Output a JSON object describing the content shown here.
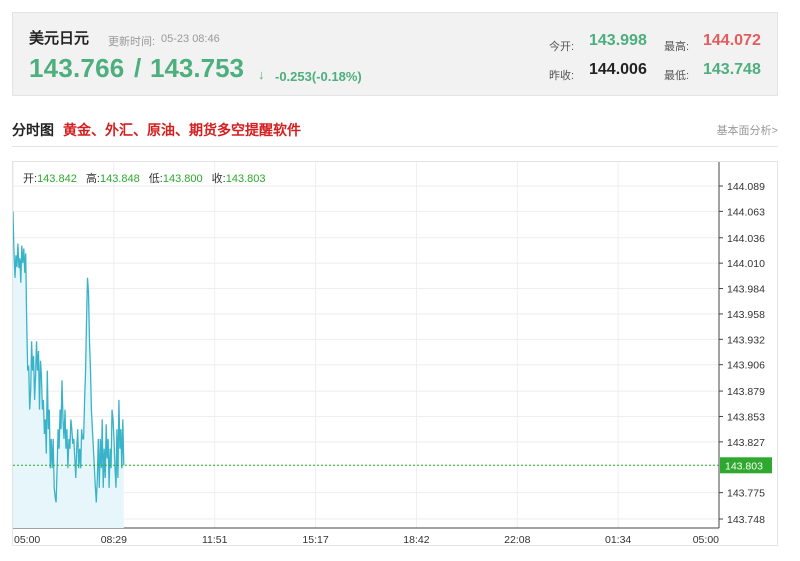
{
  "quote": {
    "name": "美元日元",
    "time_label": "更新时间:",
    "time": "05-23 08:46",
    "bid": "143.766",
    "slash": "/",
    "ask": "143.753",
    "arrow": "↓",
    "change": "-0.253(-0.18%)",
    "open_label": "今开:",
    "open": "143.998",
    "high_label": "最高:",
    "high": "144.072",
    "prev_close_label": "昨收:",
    "prev_close": "144.006",
    "low_label": "最低:",
    "low": "143.748"
  },
  "section": {
    "title": "分时图",
    "ad": "黄金、外汇、原油、期货多空提醒软件",
    "link": "基本面分析>"
  },
  "info_bar": {
    "open_label": "开:",
    "open": "143.842",
    "high_label": "高:",
    "high": "143.848",
    "low_label": "低:",
    "low": "143.800",
    "close_label": "收:",
    "close": "143.803"
  },
  "colors": {
    "line": "#39b3c9",
    "fill": "#e6f6fb",
    "last_price_line": "#2ea82e",
    "grid": "#eeeeee"
  },
  "chart_data": {
    "type": "line",
    "x_ticks": [
      "05:00",
      "08:29",
      "11:51",
      "15:17",
      "18:42",
      "22:08",
      "01:34",
      "05:00"
    ],
    "y_ticks": [
      "144.089",
      "144.063",
      "144.036",
      "144.010",
      "143.984",
      "143.958",
      "143.932",
      "143.906",
      "143.879",
      "143.853",
      "143.827",
      "143.803",
      "143.775",
      "143.748"
    ],
    "ylim": [
      143.748,
      144.089
    ],
    "x_range_minutes": [
      0,
      1440
    ],
    "last_price": 143.803,
    "last_price_label": "143.803",
    "series": [
      {
        "x": [
          0,
          2,
          4,
          6,
          8,
          10,
          12,
          14,
          16,
          18,
          20,
          22,
          24,
          26,
          28,
          30,
          32,
          34,
          36,
          38,
          40,
          42,
          44,
          46,
          48,
          50,
          52,
          54,
          56,
          58,
          60,
          62,
          64,
          66,
          68,
          70,
          72,
          74,
          76,
          78,
          80,
          82,
          84,
          86,
          88,
          90,
          92,
          94,
          96,
          98,
          100,
          102,
          104,
          106,
          108,
          110,
          112,
          114,
          116,
          118,
          120,
          122,
          124,
          126,
          128,
          130,
          132,
          134,
          136,
          138,
          140,
          142,
          144,
          146,
          148,
          150,
          152,
          154,
          156,
          158,
          160,
          162,
          164,
          166,
          168,
          170,
          172,
          174,
          176,
          178,
          180,
          182,
          184,
          186,
          188,
          190,
          192,
          194,
          196,
          198,
          200,
          202,
          204,
          206,
          208,
          210,
          212,
          214,
          216,
          218,
          220,
          222,
          224,
          226
        ],
        "y": [
          144.063,
          144.02,
          143.995,
          144.018,
          144.006,
          144.03,
          144.005,
          144.015,
          143.99,
          144.028,
          144.01,
          144.025,
          144.0,
          144.02,
          143.95,
          143.9,
          143.905,
          143.86,
          143.88,
          143.93,
          143.9,
          143.915,
          143.87,
          143.895,
          143.93,
          143.9,
          143.92,
          143.86,
          143.91,
          143.895,
          143.86,
          143.87,
          143.835,
          143.85,
          143.815,
          143.9,
          143.84,
          143.86,
          143.8,
          143.83,
          143.8,
          143.83,
          143.78,
          143.77,
          143.765,
          143.8,
          143.84,
          143.82,
          143.86,
          143.84,
          143.89,
          143.85,
          143.83,
          143.86,
          143.82,
          143.84,
          143.8,
          143.83,
          143.82,
          143.85,
          143.84,
          143.825,
          143.83,
          143.81,
          143.79,
          143.82,
          143.84,
          143.8,
          143.82,
          143.8,
          143.84,
          143.83,
          143.83,
          143.87,
          143.9,
          143.95,
          143.995,
          143.98,
          143.93,
          143.9,
          143.86,
          143.84,
          143.82,
          143.8,
          143.78,
          143.765,
          143.79,
          143.83,
          143.78,
          143.83,
          143.8,
          143.85,
          143.78,
          143.82,
          143.79,
          143.845,
          143.81,
          143.83,
          143.78,
          143.82,
          143.8,
          143.86,
          143.85,
          143.83,
          143.8,
          143.78,
          143.84,
          143.79,
          143.87,
          143.82,
          143.84,
          143.8,
          143.85,
          143.803
        ]
      }
    ]
  }
}
